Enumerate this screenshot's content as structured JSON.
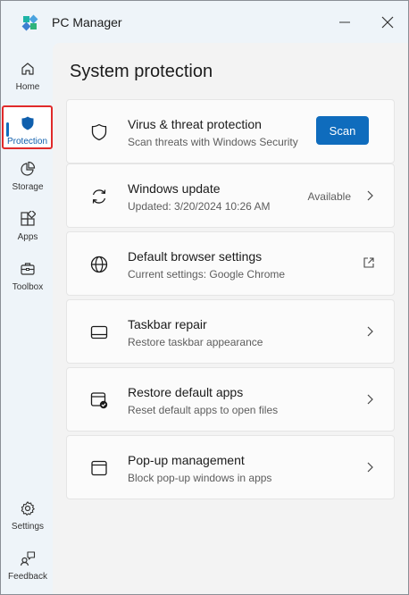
{
  "app": {
    "title": "PC Manager"
  },
  "sidebar": {
    "items": [
      {
        "label": "Home",
        "icon": "home-icon"
      },
      {
        "label": "Protection",
        "icon": "shield-icon"
      },
      {
        "label": "Storage",
        "icon": "pie-chart-icon"
      },
      {
        "label": "Apps",
        "icon": "apps-icon"
      },
      {
        "label": "Toolbox",
        "icon": "toolbox-icon"
      }
    ],
    "bottom": [
      {
        "label": "Settings",
        "icon": "gear-icon"
      },
      {
        "label": "Feedback",
        "icon": "feedback-icon"
      }
    ],
    "active": "Protection"
  },
  "main": {
    "title": "System protection",
    "cards": [
      {
        "title": "Virus & threat protection",
        "subtitle": "Scan threats with Windows Security",
        "action": "Scan",
        "icon": "shield-outline-icon"
      },
      {
        "title": "Windows update",
        "subtitle": "Updated: 3/20/2024 10:26 AM",
        "status": "Available",
        "icon": "sync-icon"
      },
      {
        "title": "Default browser settings",
        "subtitle": "Current settings: Google Chrome",
        "icon": "globe-icon",
        "trailing": "external-link-icon"
      },
      {
        "title": "Taskbar repair",
        "subtitle": "Restore taskbar appearance",
        "icon": "taskbar-icon"
      },
      {
        "title": "Restore default apps",
        "subtitle": "Reset default apps to open files",
        "icon": "default-apps-icon"
      },
      {
        "title": "Pop-up management",
        "subtitle": "Block pop-up windows in apps",
        "icon": "window-icon"
      }
    ]
  },
  "colors": {
    "accent": "#0f6cbd",
    "highlight_border": "#e02a2a",
    "sidebar_bg": "#eef4f9",
    "content_bg": "#f3f3f3"
  }
}
